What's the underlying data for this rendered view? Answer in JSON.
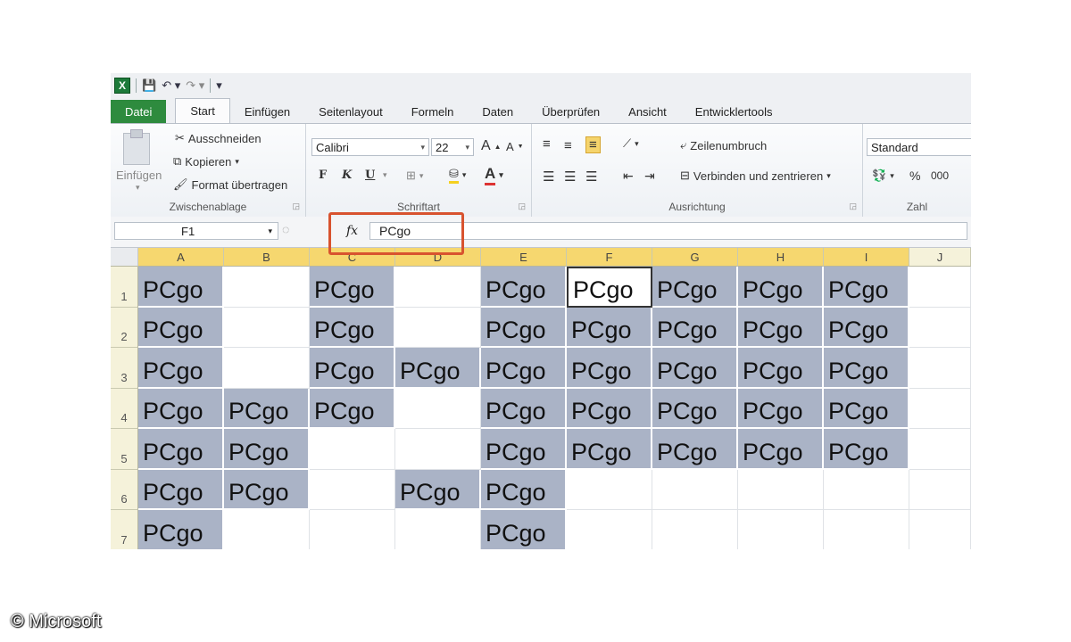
{
  "window": {
    "qat": {
      "logo": "X",
      "save_icon": "save-icon",
      "undo_icon": "undo-icon",
      "redo_icon": "redo-icon"
    },
    "tabs": [
      "Datei",
      "Start",
      "Einfügen",
      "Seitenlayout",
      "Formeln",
      "Daten",
      "Überprüfen",
      "Ansicht",
      "Entwicklertools"
    ],
    "active_tab": "Start",
    "clipboard": {
      "paste_label": "Einfügen",
      "cut_label": "Ausschneiden",
      "copy_label": "Kopieren",
      "format_label": "Format übertragen",
      "group_label": "Zwischenablage"
    },
    "font": {
      "font_name": "Calibri",
      "font_size": "22",
      "bold_label": "F",
      "italic_label": "K",
      "underline_label": "U",
      "group_label": "Schriftart",
      "grow_label": "A",
      "shrink_label": "A"
    },
    "alignment": {
      "wrap_label": "Zeilenumbruch",
      "merge_label": "Verbinden und zentrieren",
      "group_label": "Ausrichtung"
    },
    "number": {
      "format": "Standard",
      "percent_label": "%",
      "thousands_label": "000",
      "group_label": "Zahl"
    },
    "formula_bar": {
      "name_box": "F1",
      "fx_label": "fx",
      "content": "PCgo"
    },
    "columns": [
      "A",
      "B",
      "C",
      "D",
      "E",
      "F",
      "G",
      "H",
      "I",
      "J"
    ],
    "rows": [
      "1",
      "2",
      "3",
      "4",
      "5",
      "6",
      "7"
    ],
    "cell_text": "PCgo",
    "filled_cells": {
      "1": [
        "A",
        "C",
        "E",
        "F",
        "G",
        "H",
        "I"
      ],
      "2": [
        "A",
        "C",
        "E",
        "F",
        "G",
        "H",
        "I"
      ],
      "3": [
        "A",
        "C",
        "D",
        "E",
        "F",
        "G",
        "H",
        "I"
      ],
      "4": [
        "A",
        "B",
        "C",
        "E",
        "F",
        "G",
        "H",
        "I"
      ],
      "5": [
        "A",
        "B",
        "E",
        "F",
        "G",
        "H",
        "I"
      ],
      "6": [
        "A",
        "B",
        "D",
        "E"
      ],
      "7": [
        "A",
        "E"
      ]
    },
    "active_cell": "F1",
    "selected_columns": [
      "A",
      "B",
      "C",
      "D",
      "E",
      "F",
      "G",
      "H",
      "I"
    ],
    "colors": {
      "filled": "#aab3c6",
      "highlight_box": "#d8532f",
      "file_tab": "#2e8b3e"
    }
  },
  "copyright": "© Microsoft"
}
